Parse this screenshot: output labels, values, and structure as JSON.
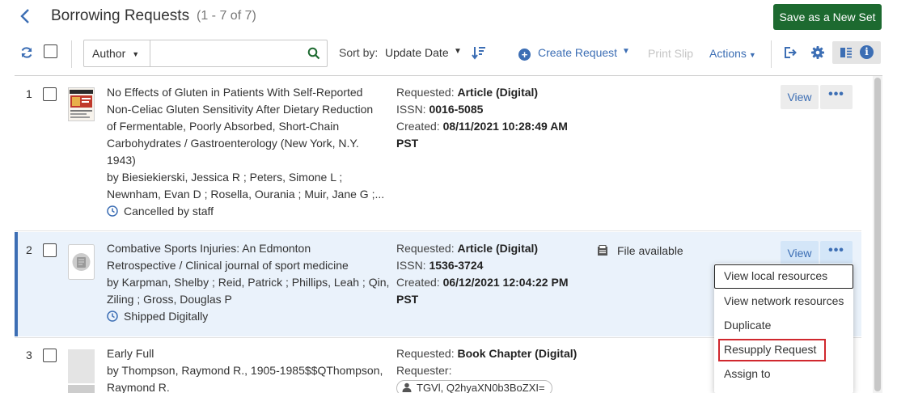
{
  "header": {
    "back_icon": "chevron-left-icon",
    "title": "Borrowing Requests",
    "count": "(1 - 7 of 7)",
    "save_set_label": "Save as a New Set"
  },
  "toolbar": {
    "refresh_icon": "refresh-icon",
    "search_field": "Author",
    "search_value": "",
    "sort_label": "Sort by:",
    "sort_value": "Update Date",
    "create_request_label": "Create Request",
    "print_slip_label": "Print Slip",
    "actions_label": "Actions",
    "accent_color": "#3c6eb4",
    "save_button_color": "#1d6a30"
  },
  "rows": [
    {
      "number": "1",
      "title_lines": [
        "No Effects of Gluten in Patients With Self-Reported",
        "Non-Celiac Gluten Sensitivity After Dietary Reduction",
        "of Fermentable, Poorly Absorbed, Short-Chain",
        "Carbohydrates / Gastroenterology (New York, N.Y.",
        "1943)"
      ],
      "by_lines": [
        "by Biesiekierski, Jessica R ; Peters, Simone L ;",
        "Newnham, Evan D ; Rosella, Ourania ; Muir, Jane G ;..."
      ],
      "status": "Cancelled by staff",
      "requested_label": "Requested:",
      "requested_value": "Article (Digital)",
      "issn_label": "ISSN:",
      "issn_value": "0016-5085",
      "created_label": "Created:",
      "created_value": "08/11/2021 10:28:49 AM",
      "created_tz": "PST",
      "view_label": "View",
      "more_label": "•••"
    },
    {
      "number": "2",
      "title_lines": [
        "Combative Sports Injuries: An Edmonton",
        "Retrospective / Clinical journal of sport medicine"
      ],
      "by_lines": [
        "by Karpman, Shelby ; Reid, Patrick ; Phillips, Leah ; Qin,",
        "Ziling ; Gross, Douglas P"
      ],
      "status": "Shipped Digitally",
      "requested_label": "Requested:",
      "requested_value": "Article (Digital)",
      "issn_label": "ISSN:",
      "issn_value": "1536-3724",
      "created_label": "Created:",
      "created_value": "06/12/2021 12:04:22 PM",
      "created_tz": "PST",
      "file_available": "File available",
      "view_label": "View",
      "more_label": "•••"
    },
    {
      "number": "3",
      "title_lines": [
        "Early Full"
      ],
      "by_lines": [
        "by Thompson, Raymond R., 1905-1985$$QThompson,",
        "Raymond R."
      ],
      "requested_label": "Requested:",
      "requested_value": "Book Chapter (Digital)",
      "requester_label": "Requester:",
      "requester_value": "TGVl, Q2hyaXN0b3BoZXI="
    }
  ],
  "row_menu": {
    "items": [
      "View local resources",
      "View network resources",
      "Duplicate",
      "Resupply Request",
      "Assign to"
    ],
    "highlight_color": "#d0282e"
  }
}
